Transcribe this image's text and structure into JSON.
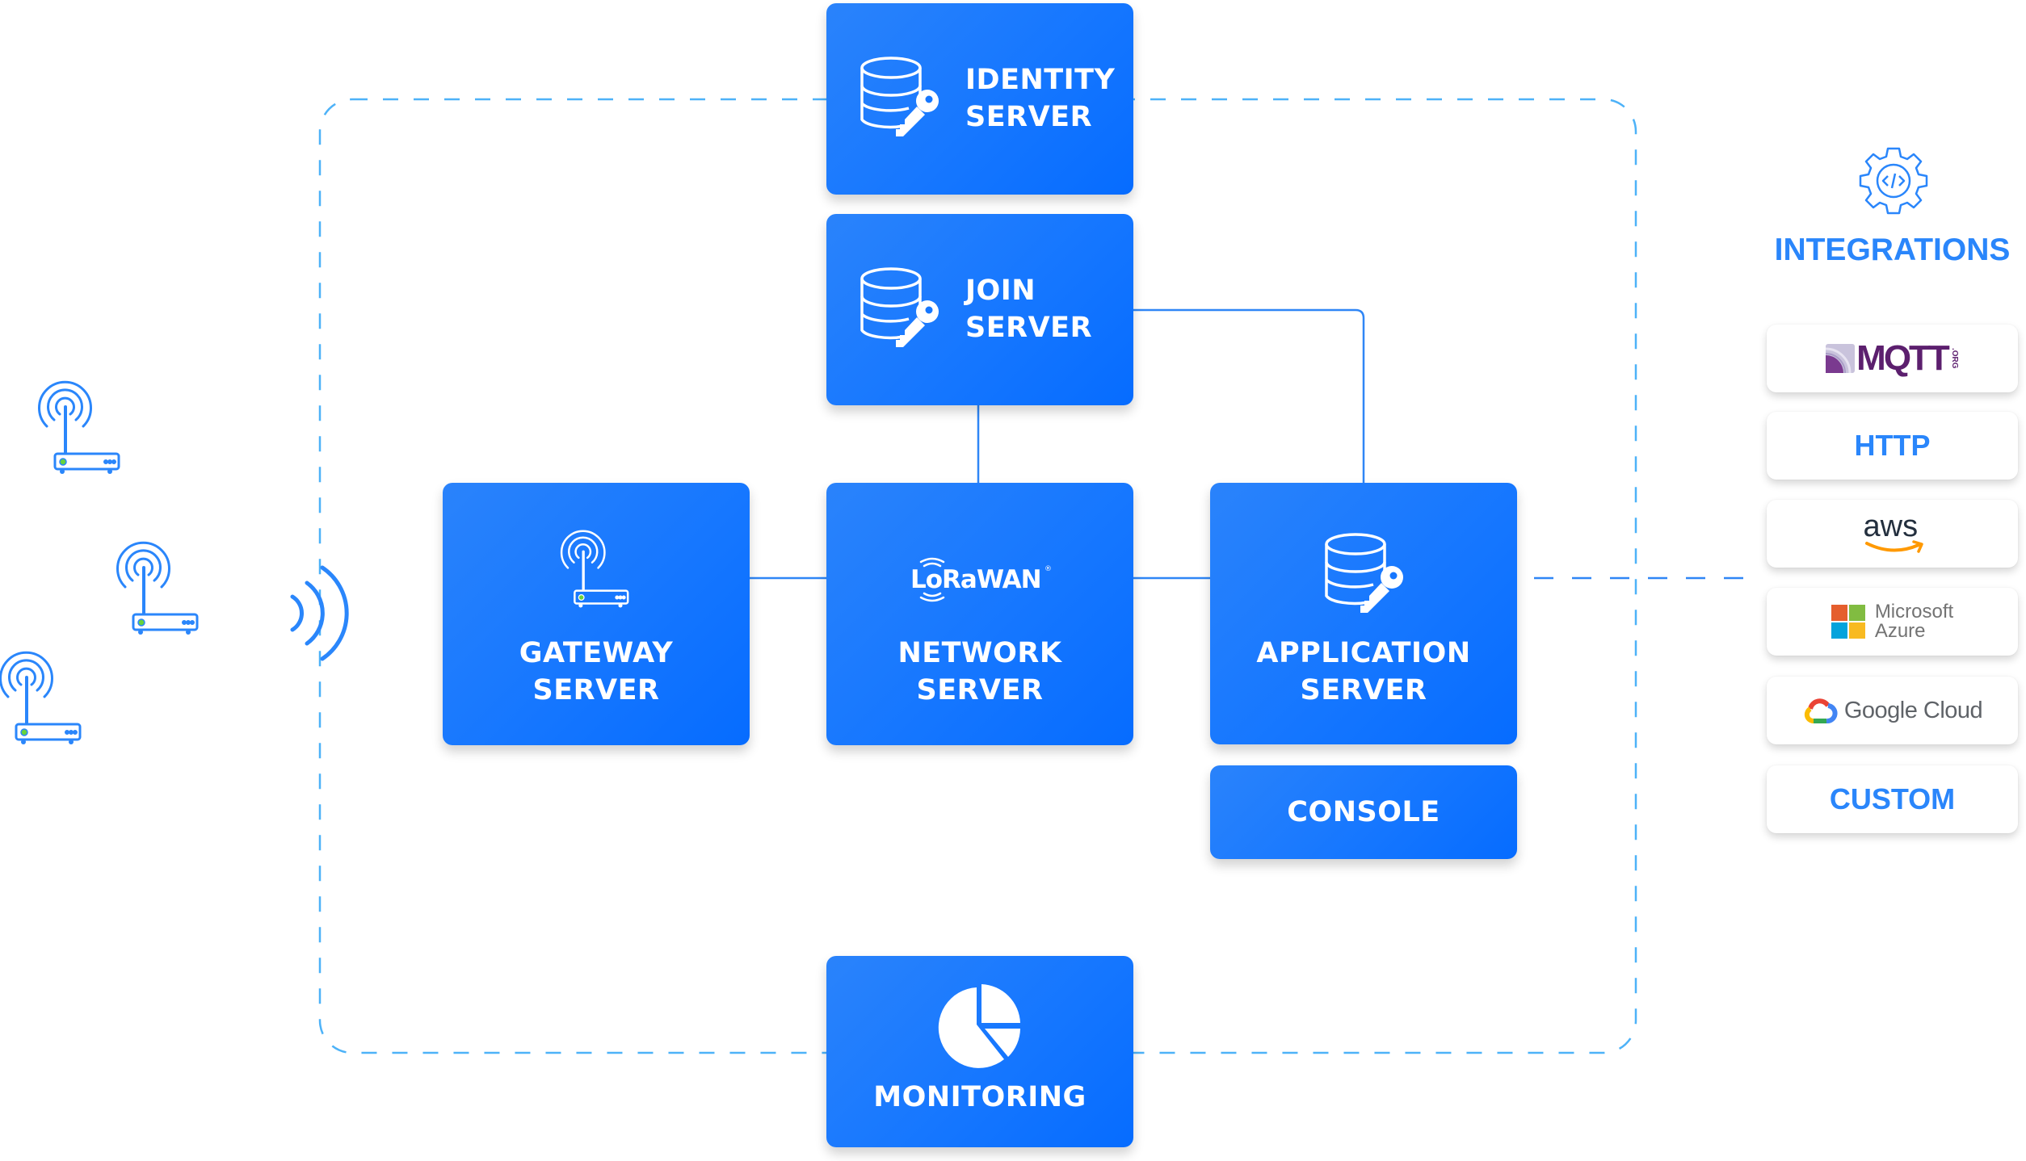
{
  "diagram": {
    "colors": {
      "box_primary": "#1677ff",
      "connector": "#2f86f6",
      "boundary_dashed": "#4db2f8",
      "integration_text": "#2a86fb",
      "led_green": "#67d33b"
    },
    "servers": {
      "identity": {
        "line1": "IDENTITY",
        "line2": "SERVER",
        "icon": "database-key-icon"
      },
      "join": {
        "line1": "JOIN",
        "line2": "SERVER",
        "icon": "database-key-icon"
      },
      "gateway": {
        "line1": "GATEWAY",
        "line2": "SERVER",
        "icon": "gateway-router-icon"
      },
      "network": {
        "line1": "NETWORK",
        "line2": "SERVER",
        "logo": "LoRaWAN",
        "trademark": "®"
      },
      "application": {
        "line1": "APPLICATION",
        "line2": "SERVER",
        "icon": "database-key-icon"
      },
      "console": {
        "label": "CONSOLE"
      },
      "monitoring": {
        "label": "MONITORING",
        "icon": "pie-chart-icon"
      }
    },
    "devices": [
      {
        "name": "gateway-device-1",
        "icon": "router-antenna-icon"
      },
      {
        "name": "gateway-device-2",
        "icon": "router-antenna-icon"
      },
      {
        "name": "gateway-device-3",
        "icon": "router-antenna-icon"
      }
    ],
    "signal": {
      "icon": "radio-waves-icon"
    },
    "integrations": {
      "title": "INTEGRATIONS",
      "icon": "gear-code-icon",
      "items": [
        {
          "id": "mqtt",
          "label": "MQTT",
          "sublabel": ".ORG",
          "color": "#5c1f6e"
        },
        {
          "id": "http",
          "label": "HTTP"
        },
        {
          "id": "aws",
          "label": "aws",
          "color": "#232f3e",
          "accent": "#ff9900"
        },
        {
          "id": "azure",
          "label_line1": "Microsoft",
          "label_line2": "Azure",
          "color": "#737373"
        },
        {
          "id": "google-cloud",
          "label": "Google Cloud",
          "color": "#5f6368"
        },
        {
          "id": "custom",
          "label": "CUSTOM"
        }
      ]
    }
  }
}
